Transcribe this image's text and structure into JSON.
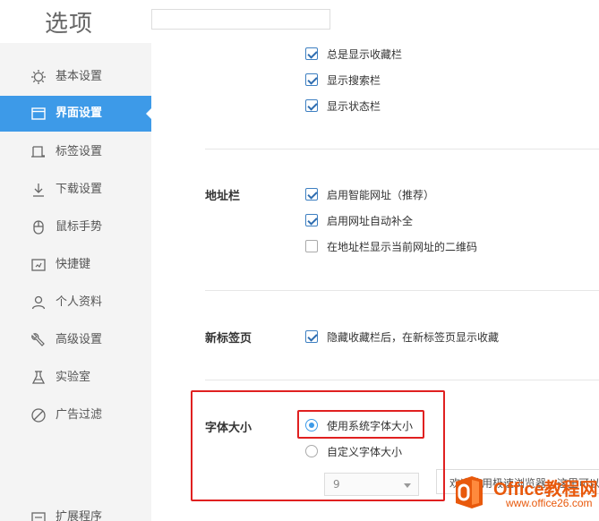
{
  "header": {
    "title": "选项",
    "search": {
      "value": "",
      "placeholder": ""
    }
  },
  "sidebar": {
    "items": [
      {
        "label": "基本设置",
        "icon": "gear-icon",
        "active": false
      },
      {
        "label": "界面设置",
        "icon": "window-icon",
        "active": true
      },
      {
        "label": "标签设置",
        "icon": "tab-icon",
        "active": false
      },
      {
        "label": "下载设置",
        "icon": "download-icon",
        "active": false
      },
      {
        "label": "鼠标手势",
        "icon": "mouse-icon",
        "active": false
      },
      {
        "label": "快捷键",
        "icon": "shortcut-icon",
        "active": false
      },
      {
        "label": "个人资料",
        "icon": "person-icon",
        "active": false
      },
      {
        "label": "高级设置",
        "icon": "wrench-icon",
        "active": false
      },
      {
        "label": "实验室",
        "icon": "flask-icon",
        "active": false
      },
      {
        "label": "广告过滤",
        "icon": "block-icon",
        "active": false
      },
      {
        "label": "扩展程序",
        "icon": "extension-icon",
        "active": false
      }
    ]
  },
  "content": {
    "toolbar_options": [
      {
        "label": "总是显示收藏栏",
        "checked": true
      },
      {
        "label": "显示搜索栏",
        "checked": true
      },
      {
        "label": "显示状态栏",
        "checked": true
      }
    ],
    "address_bar": {
      "label": "地址栏",
      "options": [
        {
          "label": "启用智能网址（推荐）",
          "checked": true
        },
        {
          "label": "启用网址自动补全",
          "checked": true
        },
        {
          "label": "在地址栏显示当前网址的二维码",
          "checked": false
        }
      ]
    },
    "new_tab": {
      "label": "新标签页",
      "options": [
        {
          "label": "隐藏收藏栏后，在新标签页显示收藏",
          "checked": true
        }
      ]
    },
    "font_size": {
      "label": "字体大小",
      "options": [
        {
          "label": "使用系统字体大小",
          "selected": true
        },
        {
          "label": "自定义字体大小",
          "selected": false
        }
      ],
      "select_value": "9",
      "tip": "欢迎使用极速浏览器，这里可以"
    }
  },
  "colors": {
    "accent": "#3d9ae8",
    "highlight": "#e02020",
    "sidebar_bg": "#f4f4f4"
  },
  "watermark": {
    "brand": "Office教程网",
    "url": "www.office26.com"
  }
}
